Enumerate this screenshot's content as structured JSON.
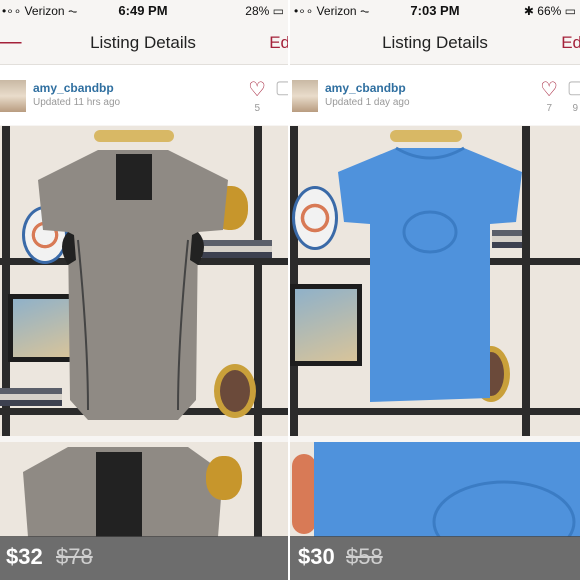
{
  "listings": [
    {
      "status": {
        "carrier": "•∘∘ Verizon ⏦",
        "time": "6:49 PM",
        "battery": "28% ▭"
      },
      "nav": {
        "back": "⟵",
        "title": "Listing Details",
        "edit": "Ed"
      },
      "user": {
        "username": "amy_cbandbp",
        "updated": "Updated 11 hrs ago",
        "likes": "5",
        "comments": ""
      },
      "price": "$32",
      "original_price": "$78",
      "shirt_color": "#8f8a84"
    },
    {
      "status": {
        "carrier": "•∘∘ Verizon ⏦",
        "time": "7:03 PM",
        "battery": "✱ 66% ▭"
      },
      "nav": {
        "back": "⟵",
        "title": "Listing Details",
        "edit": "Ed"
      },
      "user": {
        "username": "amy_cbandbp",
        "updated": "Updated 1 day ago",
        "likes": "7",
        "comments": "9"
      },
      "price": "$30",
      "original_price": "$58",
      "shirt_color": "#4f92dc"
    }
  ],
  "icons": {
    "like": "heart-icon",
    "comment": "comment-icon",
    "back": "back-arrow-icon"
  },
  "colors": {
    "accent": "#a4213a",
    "username": "#2f6fa0"
  }
}
